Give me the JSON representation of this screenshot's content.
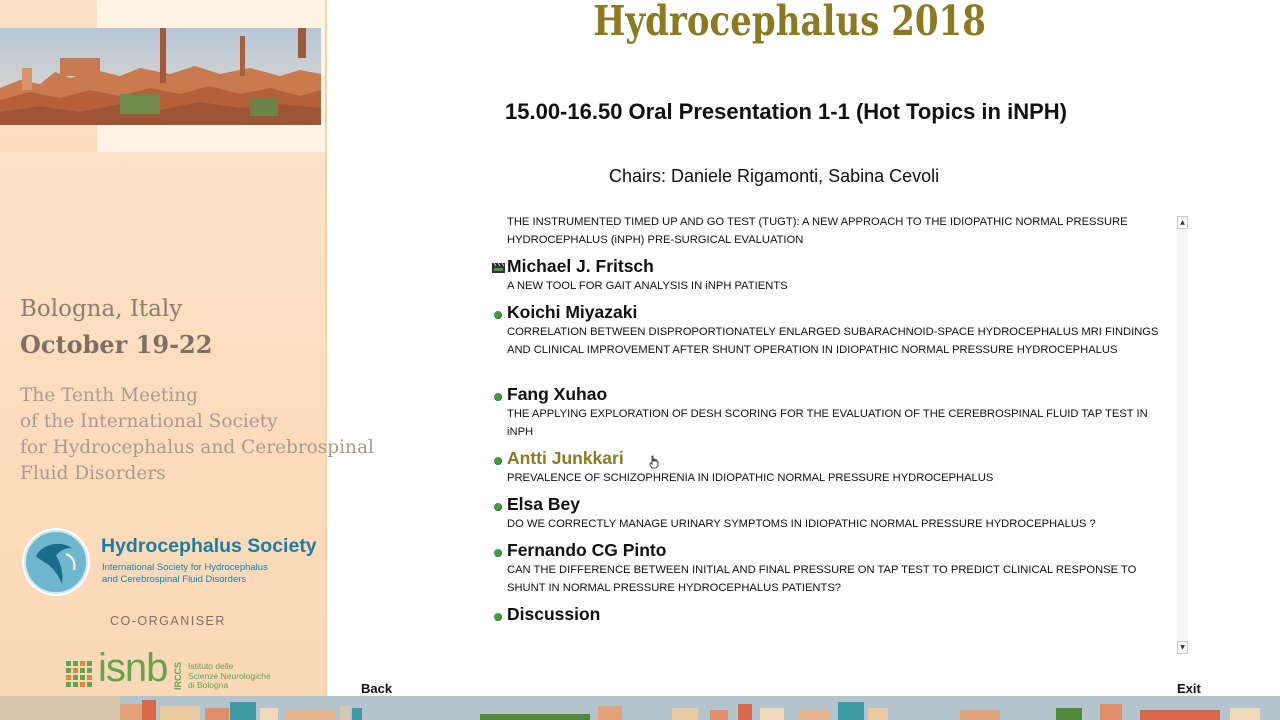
{
  "header": {
    "title": "Hydrocephalus 2018"
  },
  "session": {
    "title": "15.00-16.50 Oral Presentation 1-1 (Hot Topics in iNPH)",
    "chairs": "Chairs: Daniele Rigamonti, Sabina Cevoli"
  },
  "sidebar": {
    "location_city": "Bologna, Italy",
    "location_date": "October 19-22",
    "meeting": [
      "The Tenth Meeting",
      "of the International Society",
      "for Hydrocephalus and Cerebrospinal",
      "Fluid Disorders"
    ],
    "society_name": "Hydrocephalus Society",
    "society_sub": [
      "International Society for Hydrocephalus",
      "and Cerebrospinal Fluid Disorders"
    ],
    "coorganiser": "CO-ORGANISER",
    "isnb_word": "isnb",
    "isnb_irccs": "IRCCS",
    "isnb_text": [
      "Istituto delle",
      "Scienze Neurologiche",
      "di Bologna"
    ]
  },
  "presentations": [
    {
      "speaker": "",
      "marker": "none",
      "abstract": "THE INSTRUMENTED TIMED UP AND GO TEST (TUGT): A NEW APPROACH TO THE IDIOPATHIC NORMAL PRESSURE HYDROCEPHALUS (iNPH) PRE-SURGICAL EVALUATION"
    },
    {
      "speaker": "Michael J. Fritsch",
      "marker": "video-icon",
      "abstract": "A NEW TOOL FOR GAIT ANALYSIS IN iNPH PATIENTS"
    },
    {
      "speaker": "Koichi Miyazaki",
      "marker": "green-dot",
      "abstract": "CORRELATION BETWEEN DISPROPORTIONATELY ENLARGED SUBARACHNOID-SPACE HYDROCEPHALUS MRI FINDINGS AND CLINICAL IMPROVEMENT AFTER SHUNT OPERATION IN IDIOPATHIC NORMAL PRESSURE HYDROCEPHALUS"
    },
    {
      "speaker": "Fang Xuhao",
      "marker": "green-dot",
      "abstract": "THE APPLYING EXPLORATION OF DESH SCORING FOR THE EVALUATION OF THE CEREBROSPINAL FLUID TAP TEST IN iNPH"
    },
    {
      "speaker": "Antti Junkkari",
      "marker": "green-dot",
      "active": true,
      "abstract": "PREVALENCE OF SCHIZOPHRENIA IN IDIOPATHIC NORMAL PRESSURE HYDROCEPHALUS"
    },
    {
      "speaker": "Elsa Bey",
      "marker": "green-dot",
      "abstract": "DO WE CORRECTLY MANAGE URINARY SYMPTOMS IN IDIOPATHIC NORMAL PRESSURE HYDROCEPHALUS ?"
    },
    {
      "speaker": "Fernando CG Pinto",
      "marker": "green-dot",
      "abstract": "CAN THE DIFFERENCE BETWEEN INITIAL AND FINAL PRESSURE ON TAP TEST TO PREDICT CLINICAL RESPONSE TO SHUNT IN NORMAL PRESSURE HYDROCEPHALUS PATIENTS?"
    },
    {
      "speaker": "Discussion",
      "marker": "green-dot",
      "abstract": ""
    }
  ],
  "nav": {
    "back_label": "Back",
    "exit_label": "Exit"
  },
  "colors": {
    "title_gold": "#8c7a21",
    "bullet_green": "#3f9e3f",
    "sidebar_peach": "#fcdcbc",
    "society_blue": "#1b7fa4",
    "isnb_green": "#5fa64f"
  }
}
